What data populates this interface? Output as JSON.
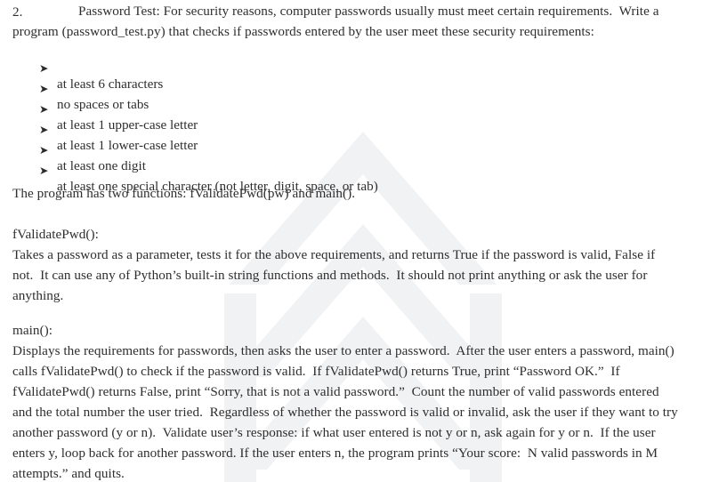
{
  "document": {
    "background_color": "#ffffff",
    "text_color": "#2e2e2e",
    "watermark_color": "#f2f3f5"
  },
  "heading": {
    "number": "2.",
    "line1": "Password Test: For security reasons, computer passwords usually must meet certain requirements.  Write a",
    "line2": "program (password_test.py) that checks if passwords entered by the user meet these security requirements:"
  },
  "requirements": {
    "bullet_glyph": "➤",
    "items": [
      "at least 6 characters",
      "no spaces or tabs",
      "at least 1 upper-case letter",
      "at least 1 lower-case letter",
      "at least one digit",
      "at least one special character (not letter, digit, space, or tab)"
    ]
  },
  "overview": {
    "line1": "The program has two functions: fValidatePwd(pw) and main()."
  },
  "validate_section": {
    "title": "fValidatePwd():",
    "lines": [
      "Takes a password as a parameter, tests it for the above requirements, and returns True if the password is valid, False if",
      "not.  It can use any of Python’s built-in string functions and methods.  It should not print anything or ask the user for",
      "anything."
    ]
  },
  "main_section": {
    "title": "main():",
    "lines": [
      "Displays the requirements for passwords, then asks the user to enter a password.  After the user enters a password, main()",
      "calls fValidatePwd() to check if the password is valid.  If fValidatePwd() returns True, print “Password OK.”  If",
      "fValidatePwd() returns False, print “Sorry, that is not a valid password.”  Count the number of valid passwords entered",
      "and the total number the user tried.  Regardless of whether the password is valid or invalid, ask the user if they want to try",
      "another password (y or n).  Validate user’s response: if what user entered is not y or n, ask again for y or n.  If the user",
      "enters y, loop back for another password. If the user enters n, the program prints “Your score:  N valid passwords in M",
      "attempts.” and quits."
    ]
  }
}
